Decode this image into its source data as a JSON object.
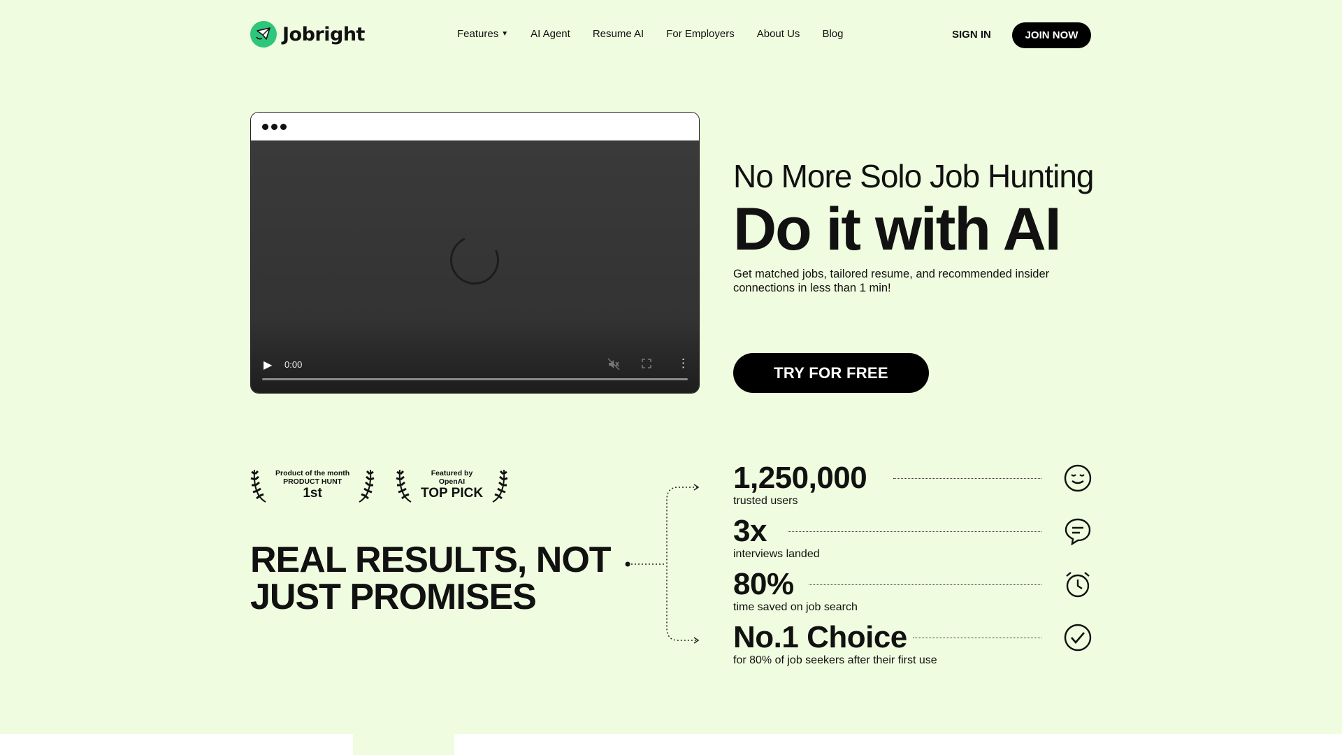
{
  "brand": {
    "name": "Jobright"
  },
  "nav": {
    "items": [
      {
        "label": "Features",
        "dropdown": true
      },
      {
        "label": "AI Agent"
      },
      {
        "label": "Resume AI"
      },
      {
        "label": "For Employers"
      },
      {
        "label": "About Us"
      },
      {
        "label": "Blog"
      }
    ],
    "sign_in": "SIGN IN",
    "join": "JOIN NOW"
  },
  "video": {
    "time": "0:00",
    "progress": 0
  },
  "hero": {
    "subtitle": "No More Solo Job Hunting",
    "title": "Do it with AI",
    "description": "Get matched jobs, tailored resume, and recommended insider connections in less than 1 min!",
    "cta": "TRY FOR FREE"
  },
  "badges": [
    {
      "top": "Product of the month",
      "middle": "PRODUCT HUNT",
      "big": "1st"
    },
    {
      "top": "Featured by",
      "middle": "OpenAI",
      "big": "TOP PICK"
    }
  ],
  "results": {
    "title": "REAL RESULTS, NOT JUST PROMISES"
  },
  "stats": [
    {
      "value": "1,250,000",
      "label": "trusted users",
      "icon": "smile-icon"
    },
    {
      "value": "3x",
      "label": "interviews landed",
      "icon": "chat-icon"
    },
    {
      "value": "80%",
      "label": "time saved on job search",
      "icon": "alarm-clock-icon"
    },
    {
      "value": "No.1 Choice",
      "label": "for 80% of job seekers after their first use",
      "icon": "check-circle-icon"
    }
  ],
  "colors": {
    "background": "#effcdf",
    "brand_green": "#2ec67a",
    "button": "#000000"
  }
}
